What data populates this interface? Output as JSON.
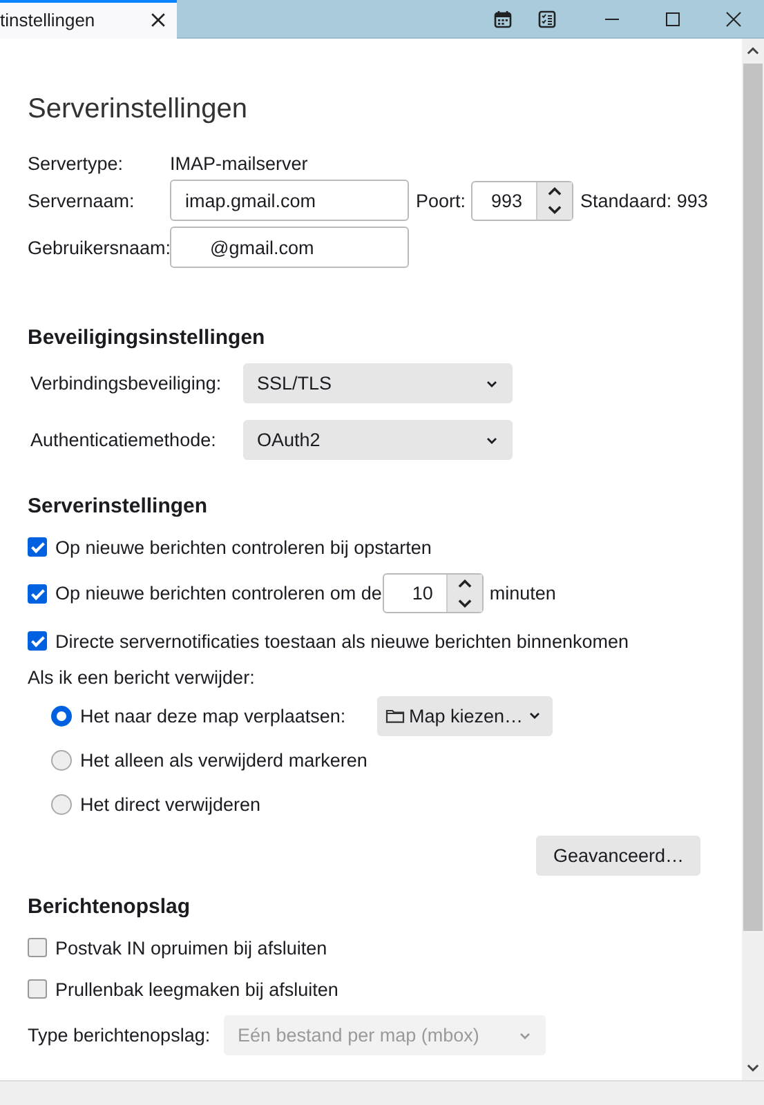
{
  "tab": {
    "title": "tinstellingen",
    "selected": true
  },
  "title": "Serverinstellingen",
  "server": {
    "type_label": "Servertype:",
    "type_value": "IMAP-mailserver",
    "name_label": "Servernaam:",
    "name_value": "imap.gmail.com",
    "port_label": "Poort:",
    "port_value": "993",
    "default_port": "Standaard: 993",
    "user_label": "Gebruikersnaam:",
    "user_value": "@gmail.com"
  },
  "sections": [
    {
      "heading": "Beveiligingsinstellingen",
      "items": [
        {
          "kind": "select",
          "label": "Verbindingsbeveiliging:",
          "value": "SSL/TLS",
          "disabled": false
        },
        {
          "kind": "select",
          "label": "Authenticatiemethode:",
          "value": "OAuth2",
          "disabled": false
        }
      ]
    },
    {
      "heading": "Serverinstellingen",
      "items": [
        {
          "kind": "checkbox",
          "label": "Op nieuwe berichten controleren bij opstarten",
          "checked": true
        },
        {
          "kind": "checkspin",
          "label": "Op nieuwe berichten controleren om de",
          "checked": true,
          "value": "10",
          "suffix": "minuten"
        },
        {
          "kind": "checkbox",
          "label": "Directe servernotificaties toestaan als nieuwe berichten binnenkomen",
          "checked": true
        },
        {
          "kind": "text",
          "label": "Als ik een bericht verwijder:"
        },
        {
          "kind": "radio",
          "label": "Het naar deze map verplaatsen:",
          "selected": true,
          "picker": "Map kiezen…"
        },
        {
          "kind": "radio",
          "label": "Het alleen als verwijderd markeren",
          "selected": false
        },
        {
          "kind": "radio",
          "label": "Het direct verwijderen",
          "selected": false
        },
        {
          "kind": "button",
          "label": "Geavanceerd…"
        }
      ]
    },
    {
      "heading": "Berichtenopslag",
      "items": [
        {
          "kind": "checkbox",
          "label": "Postvak IN opruimen bij afsluiten",
          "checked": false
        },
        {
          "kind": "checkbox",
          "label": "Prullenbak leegmaken bij afsluiten",
          "checked": false
        },
        {
          "kind": "select",
          "label": "Type berichtenopslag:",
          "value": "Eén bestand per map (mbox)",
          "disabled": true
        }
      ]
    }
  ]
}
